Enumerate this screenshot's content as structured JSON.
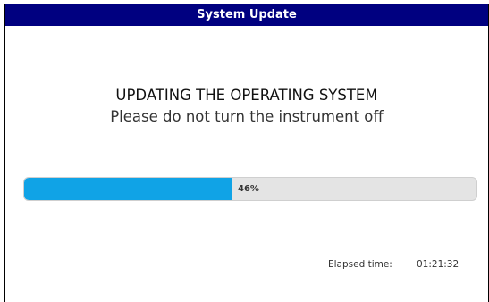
{
  "window": {
    "title": "System Update",
    "title_bar_color": "#000080"
  },
  "message": {
    "heading": "UPDATING THE OPERATING SYSTEM",
    "subheading": "Please do not turn the instrument off"
  },
  "progress": {
    "percent": 46,
    "label": "46%",
    "fill_color": "#10a3e6"
  },
  "elapsed": {
    "label": "Elapsed time:",
    "value": "01:21:32"
  }
}
